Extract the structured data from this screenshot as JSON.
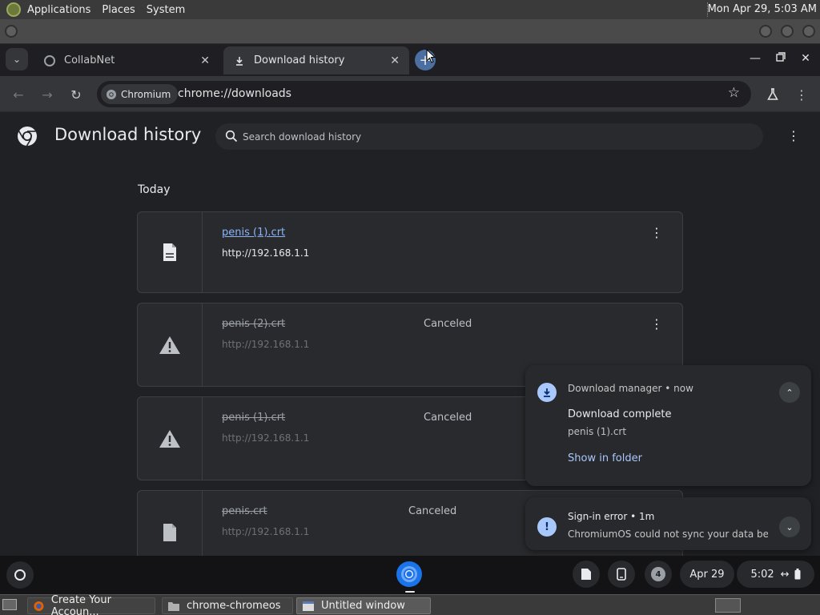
{
  "gnome": {
    "menus": [
      "Applications",
      "Places",
      "System"
    ],
    "clock": "Mon Apr 29,  5:03 AM",
    "taskbar": [
      {
        "label": "Create Your Accoun...",
        "active": false
      },
      {
        "label": "chrome-chromeos",
        "active": false
      },
      {
        "label": "Untitled window",
        "active": true
      }
    ]
  },
  "browser": {
    "tabs": [
      {
        "title": "CollabNet",
        "icon": "globe-icon",
        "active": false
      },
      {
        "title": "Download history",
        "icon": "download-icon",
        "active": true
      }
    ],
    "omnibox": {
      "chip_label": "Chromium",
      "url": "chrome://downloads"
    }
  },
  "downloads_page": {
    "title": "Download history",
    "search_placeholder": "Search download history",
    "day_label": "Today",
    "items": [
      {
        "filename": "penis (1).crt",
        "source": "http://192.168.1.1",
        "status": "",
        "icon": "file-icon",
        "canceled": false
      },
      {
        "filename": "penis (2).crt",
        "source": "http://192.168.1.1",
        "status": "Canceled",
        "icon": "warning-icon",
        "canceled": true
      },
      {
        "filename": "penis (1).crt",
        "source": "http://192.168.1.1",
        "status": "Canceled",
        "icon": "warning-icon",
        "canceled": true
      },
      {
        "filename": "penis.crt",
        "source": "http://192.168.1.1",
        "status": "Canceled",
        "icon": "file-icon",
        "canceled": true
      }
    ]
  },
  "notifications": [
    {
      "app": "Download manager",
      "time": "now",
      "title": "Download complete",
      "body": "penis (1).crt",
      "action": "Show in folder"
    },
    {
      "app": "Sign-in error",
      "time": "1m",
      "body": "ChromiumOS could not sync your data bec..."
    }
  ],
  "shelf": {
    "notification_count": "4",
    "date": "Apr 29",
    "time": "5:02"
  },
  "colors": {
    "page_bg": "#202124",
    "card_bg": "#292a2d",
    "link": "#8ab4f8",
    "accent": "#a8c7fa"
  }
}
